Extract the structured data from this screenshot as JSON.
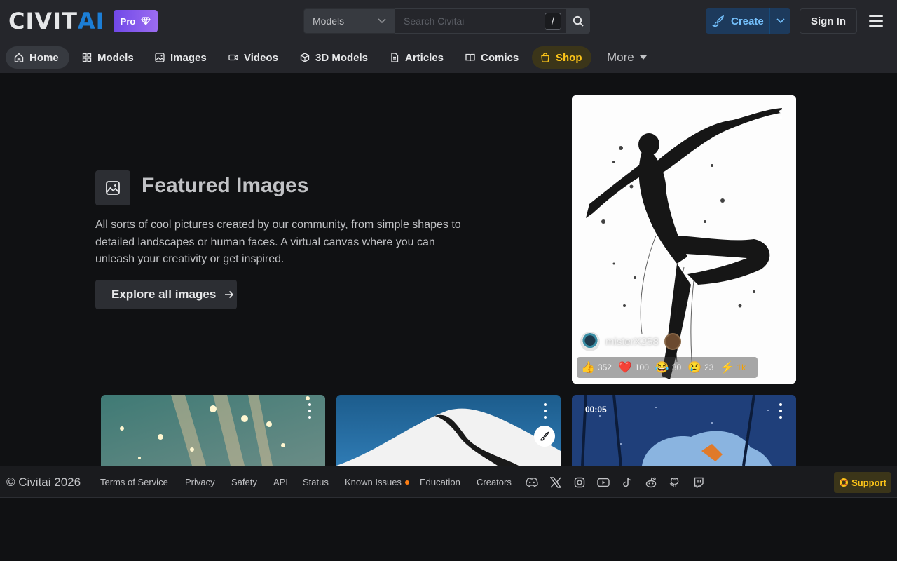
{
  "brand": {
    "logo_main": "CIVIT",
    "logo_accent": "AI",
    "pro_label": "Pro"
  },
  "search": {
    "scope_value": "Models",
    "placeholder": "Search Civitai",
    "shortcut": "/"
  },
  "header": {
    "create_label": "Create",
    "signin_label": "Sign In"
  },
  "nav": {
    "items": [
      {
        "label": "Home",
        "icon": "home-icon"
      },
      {
        "label": "Models",
        "icon": "grid-icon"
      },
      {
        "label": "Images",
        "icon": "image-icon"
      },
      {
        "label": "Videos",
        "icon": "video-icon"
      },
      {
        "label": "3D Models",
        "icon": "cube-icon"
      },
      {
        "label": "Articles",
        "icon": "file-icon"
      },
      {
        "label": "Comics",
        "icon": "book-icon"
      },
      {
        "label": "Shop",
        "icon": "shopping-bag-icon"
      }
    ],
    "more_label": "More"
  },
  "hero": {
    "title": "Featured Images",
    "description": "All sorts of cool pictures created by our community, from simple shapes to detailed landscapes or human faces. A virtual canvas where you can unleash your creativity or get inspired.",
    "cta_label": "Explore all images"
  },
  "featured_card": {
    "author": "misterX258",
    "reactions": [
      {
        "emoji": "👍",
        "count": "352"
      },
      {
        "emoji": "❤️",
        "count": "100"
      },
      {
        "emoji": "😂",
        "count": "30"
      },
      {
        "emoji": "😢",
        "count": "23"
      },
      {
        "emoji": "⚡",
        "count": "1k"
      }
    ]
  },
  "grid_cards": [
    {
      "duration": ""
    },
    {
      "duration": ""
    },
    {
      "duration": "00:05"
    }
  ],
  "footer": {
    "copyright": "© Civitai 2026",
    "links": [
      "Terms of Service",
      "Privacy",
      "Safety",
      "API",
      "Status",
      "Known Issues",
      "Education",
      "Creators"
    ],
    "social_icons": [
      "discord-icon",
      "x-icon",
      "instagram-icon",
      "youtube-icon",
      "tiktok-icon",
      "reddit-icon",
      "github-icon",
      "twitch-icon"
    ],
    "support_label": "Support"
  },
  "colors": {
    "accent": "#1c7ed6",
    "shop": "#fcc419",
    "pro_start": "#7048e8",
    "buzz": "#f59f00",
    "issue_dot": "#fd7e14"
  }
}
